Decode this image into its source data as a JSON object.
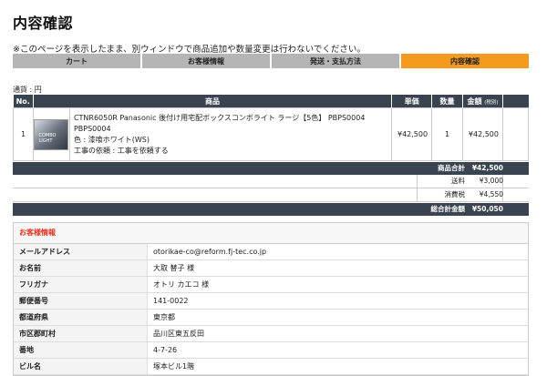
{
  "page": {
    "title": "内容確認",
    "notice": "※このページを表示したまま、別ウィンドウで商品追加や数量変更は行わないでください。"
  },
  "steps": [
    {
      "label": "カート"
    },
    {
      "label": "お客様情報"
    },
    {
      "label": "発送・支払方法"
    },
    {
      "label": "内容確認"
    }
  ],
  "currency_label": "通貨 : 円",
  "order_table": {
    "headers": {
      "no": "No.",
      "product": "商品",
      "price": "単価",
      "qty": "数量",
      "amount": "金額",
      "amount_note": "(税別)"
    },
    "rows": [
      {
        "no": "1",
        "product_name": "CTNR6050R Panasonic 後付け用宅配ボックスコンボライト ラージ【5色】 PBPS0004",
        "product_code": "PBPS0004",
        "color": "色 : 漆喰ホワイト(WS)",
        "construction": "工事の依頼 : 工事を依頼する",
        "price": "¥42,500",
        "qty": "1",
        "amount": "¥42,500"
      }
    ]
  },
  "totals": {
    "subtotal_label": "商品合計",
    "subtotal_value": "¥42,500",
    "shipping_label": "送料",
    "shipping_value": "¥3,000",
    "tax_label": "消費税",
    "tax_value": "¥4,550",
    "grand_label": "総合計金額",
    "grand_value": "¥50,050"
  },
  "customer": {
    "heading": "お客様情報",
    "rows": [
      {
        "label": "メールアドレス",
        "value": "otorikae-co@reform.fj-tec.co.jp"
      },
      {
        "label": "お名前",
        "value": "大取 替子 様"
      },
      {
        "label": "フリガナ",
        "value": "オトリ カエコ 様"
      },
      {
        "label": "郵便番号",
        "value": "141-0022"
      },
      {
        "label": "都道府県",
        "value": "東京都"
      },
      {
        "label": "市区郡町村",
        "value": "品川区東五反田"
      },
      {
        "label": "番地",
        "value": "4-7-26"
      },
      {
        "label": "ビル名",
        "value": "塚本ビル1階"
      }
    ]
  },
  "colors": {
    "active_step": "#f39a1f",
    "inactive_step": "#b5b5b5",
    "table_header": "#3a4451",
    "section_heading": "#e8321f"
  }
}
